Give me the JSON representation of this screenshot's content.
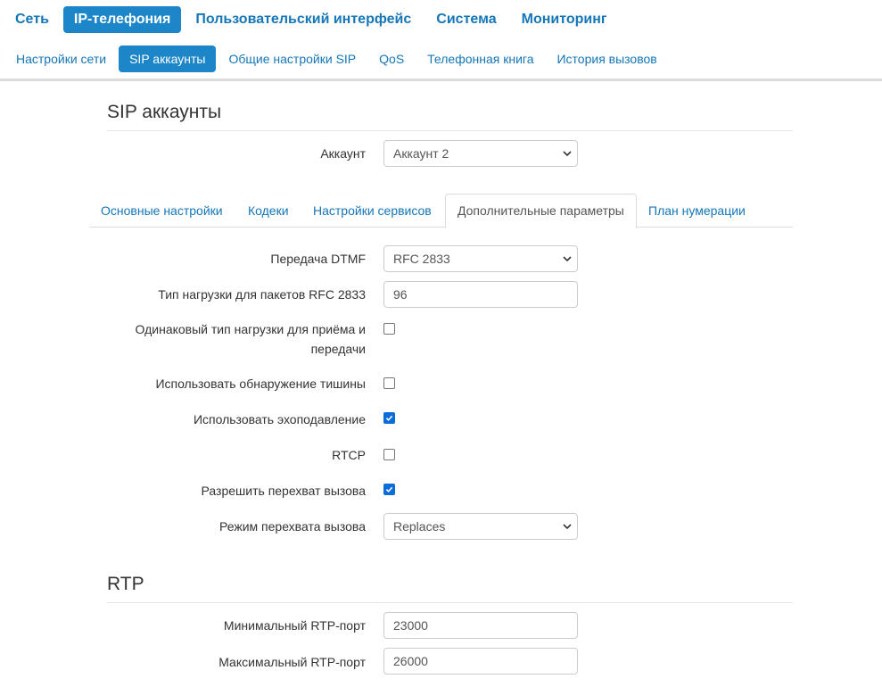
{
  "topnav": [
    "Сеть",
    "IP-телефония",
    "Пользовательский интерфейс",
    "Система",
    "Мониторинг"
  ],
  "subnav": [
    "Настройки сети",
    "SIP аккаунты",
    "Общие настройки SIP",
    "QoS",
    "Телефонная книга",
    "История вызовов"
  ],
  "page_title": "SIP аккаунты",
  "account": {
    "label": "Аккаунт",
    "value": "Аккаунт 2"
  },
  "tabs": [
    "Основные настройки",
    "Кодеки",
    "Настройки сервисов",
    "Дополнительные параметры",
    "План нумерации"
  ],
  "form": {
    "dtmf": {
      "label": "Передача DTMF",
      "value": "RFC 2833"
    },
    "payload_type": {
      "label": "Тип нагрузки для пакетов RFC 2833",
      "value": "96"
    },
    "same_payload": {
      "label_line1": "Одинаковый тип нагрузки для приёма и",
      "label_line2": "передачи",
      "checked": false
    },
    "silence_detection": {
      "label": "Использовать обнаружение тишины",
      "checked": false
    },
    "echo_cancel": {
      "label": "Использовать эхоподавление",
      "checked": true
    },
    "rtcp": {
      "label": "RTCP",
      "checked": false
    },
    "call_pickup": {
      "label": "Разрешить перехват вызова",
      "checked": true
    },
    "pickup_mode": {
      "label": "Режим перехвата вызова",
      "value": "Replaces"
    }
  },
  "rtp": {
    "title": "RTP",
    "min_port": {
      "label": "Минимальный RTP-порт",
      "value": "23000"
    },
    "max_port": {
      "label": "Максимальный RTP-порт",
      "value": "26000"
    }
  },
  "colors": {
    "accent": "#1c86c8",
    "link": "#1577b8",
    "checkbox": "#0a6cd8"
  }
}
